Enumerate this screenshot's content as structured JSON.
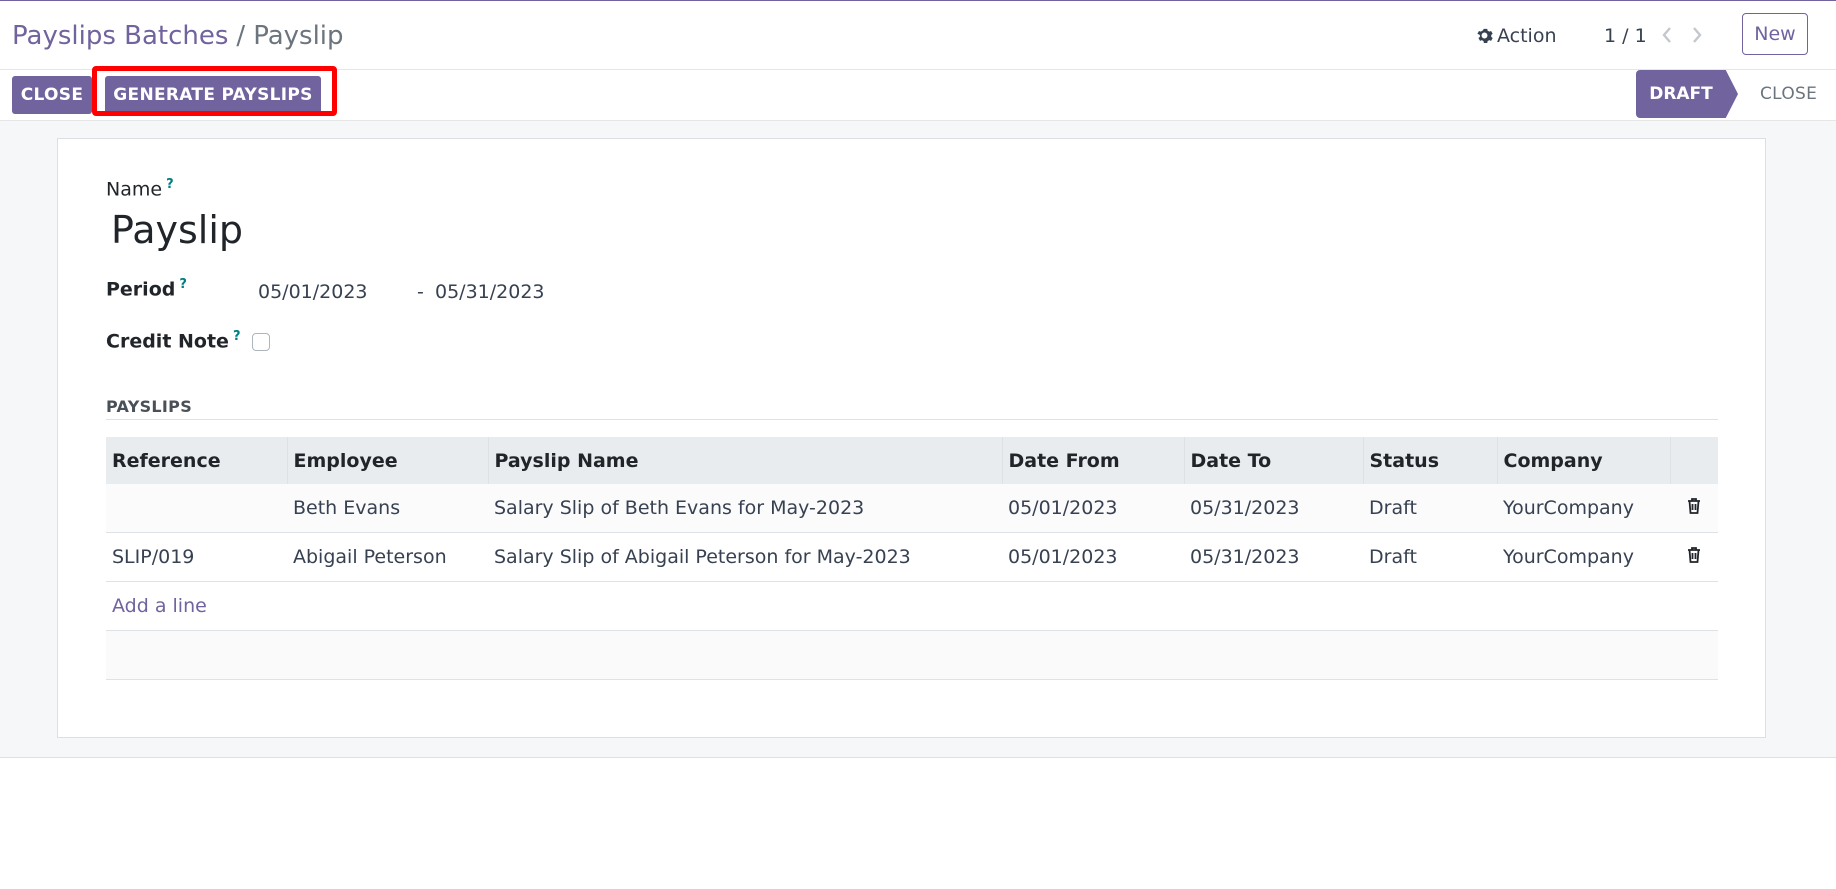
{
  "breadcrumb": {
    "parent": "Payslips Batches",
    "separator": "/",
    "current": "Payslip"
  },
  "control": {
    "action_label": "Action",
    "pager": "1 / 1",
    "new_label": "New"
  },
  "buttons": {
    "close": "CLOSE",
    "generate": "GENERATE PAYSLIPS"
  },
  "statusbar": {
    "states": [
      "DRAFT",
      "CLOSE"
    ],
    "active": "DRAFT"
  },
  "form": {
    "name_label": "Name",
    "name_value": "Payslip",
    "period_label": "Period",
    "date_start": "05/01/2023",
    "date_separator": "-",
    "date_end": "05/31/2023",
    "credit_note_label": "Credit Note",
    "credit_note_checked": false,
    "help_mark": "?"
  },
  "payslips": {
    "section_title": "PAYSLIPS",
    "columns": [
      "Reference",
      "Employee",
      "Payslip Name",
      "Date From",
      "Date To",
      "Status",
      "Company"
    ],
    "rows": [
      [
        "",
        "Beth Evans",
        "Salary Slip of Beth Evans for May-2023",
        "05/01/2023",
        "05/31/2023",
        "Draft",
        "YourCompany"
      ],
      [
        "SLIP/019",
        "Abigail Peterson",
        "Salary Slip of Abigail Peterson for May-2023",
        "05/01/2023",
        "05/31/2023",
        "Draft",
        "YourCompany"
      ]
    ],
    "add_line": "Add a line"
  },
  "colors": {
    "primary": "#71639e",
    "highlight": "#ff0000",
    "help": "#017e84"
  },
  "icons": {
    "action": "gear-icon",
    "prev": "chevron-left-icon",
    "next": "chevron-right-icon",
    "delete": "trash-icon"
  }
}
